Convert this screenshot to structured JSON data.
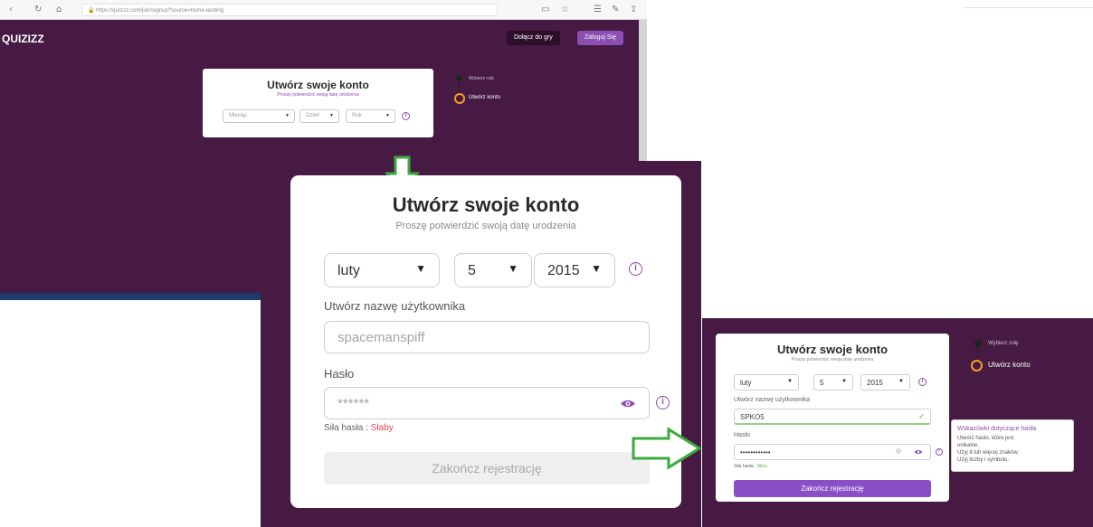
{
  "browser": {
    "nav_icons": [
      "back-icon",
      "refresh-icon",
      "home-icon",
      "lock-icon"
    ],
    "url": "https://quizizz.com/join/signup?source=home-landing",
    "logo": "QUIZIZZ",
    "join_game_label": "Dołącz do gry",
    "login_label": "Zaloguj Się",
    "colors": {
      "brand_bg": "#461a42",
      "accent": "#8a4fb0",
      "step_ring": "#f0a21b",
      "submit_active": "#8a4fc7"
    }
  },
  "small_form": {
    "title": "Utwórz swoje konto",
    "subtitle": "Proszę potwierdzić swoją datę urodzenia",
    "month_placeholder": "Miesiąc",
    "day_placeholder": "Dzień",
    "year_placeholder": "Rok",
    "step_completed": "Wybierz rolę",
    "step_current": "Utwórz konto"
  },
  "main_form": {
    "title": "Utwórz swoje konto",
    "subtitle": "Proszę potwierdzić swoją datę urodzenia",
    "month_value": "luty",
    "day_value": "5",
    "year_value": "2015",
    "username_label": "Utwórz nazwę użytkownika",
    "username_placeholder": "spacemanspiff",
    "password_label": "Hasło",
    "password_placeholder": "******",
    "strength_label": "Siła hasła :",
    "strength_value": "Słaby",
    "submit_label": "Zakończ rejestrację"
  },
  "right_form": {
    "title": "Utwórz swoje konto",
    "subtitle": "Proszę potwierdzić swoją datę urodzenia",
    "month_value": "luty",
    "day_value": "5",
    "year_value": "2015",
    "username_label": "Utwórz nazwę użytkownika",
    "username_value": "SPKO5",
    "password_label": "Hasło",
    "password_value": "••••••••••••",
    "strength_label": "Siła hasła :",
    "strength_value": "Silny",
    "submit_label": "Zakończ rejestrację",
    "step_completed": "Wybierz rolę",
    "step_current": "Utwórz konto"
  },
  "tooltip": {
    "heading": "Wskazówki dotyczące hasła",
    "lines": [
      "Utwórz hasło, które jest",
      "unikalne.",
      "Użyj 8 lub więcej znaków.",
      "Użyj liczby i symbolu."
    ]
  }
}
